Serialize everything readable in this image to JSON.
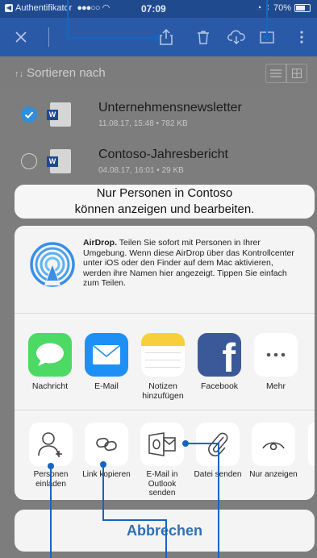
{
  "status_bar": {
    "back_app": "Authentifikator",
    "time": "07:09",
    "battery": "70%"
  },
  "sort": {
    "label": "Sortieren nach"
  },
  "files": [
    {
      "name": "Unternehmensnewsletter",
      "meta": "11.08.17, 15:48 • 782 KB",
      "selected": true,
      "badge": "W"
    },
    {
      "name": "Contoso-Jahresbericht",
      "meta": "04.08.17, 16:01 • 29 KB",
      "selected": false,
      "badge": "W"
    }
  ],
  "share_hint": {
    "line1": "Nur Personen in Contoso",
    "line2": "können anzeigen und bearbeiten."
  },
  "airdrop": {
    "title": "AirDrop.",
    "text": "Teilen Sie sofort mit Personen in Ihrer Umgebung. Wenn diese AirDrop über das Kontrollcenter unter iOS oder den Finder auf dem Mac aktivieren, werden ihre Namen hier angezeigt. Tippen Sie einfach zum Teilen."
  },
  "apps": [
    {
      "label": "Nachricht"
    },
    {
      "label": "E-Mail"
    },
    {
      "label": "Notizen hinzufügen"
    },
    {
      "label": "Facebook"
    },
    {
      "label": "Mehr"
    }
  ],
  "actions": [
    {
      "label": "Personen einladen"
    },
    {
      "label": "Link kopieren"
    },
    {
      "label": "E-Mail in Outlook senden"
    },
    {
      "label": "Datei senden"
    },
    {
      "label": "Nur anzeigen"
    }
  ],
  "cancel_label": "Abbrechen",
  "colors": {
    "accent": "#1565c0",
    "toolbar": "#2a5aa7",
    "check": "#2f8fd8"
  }
}
